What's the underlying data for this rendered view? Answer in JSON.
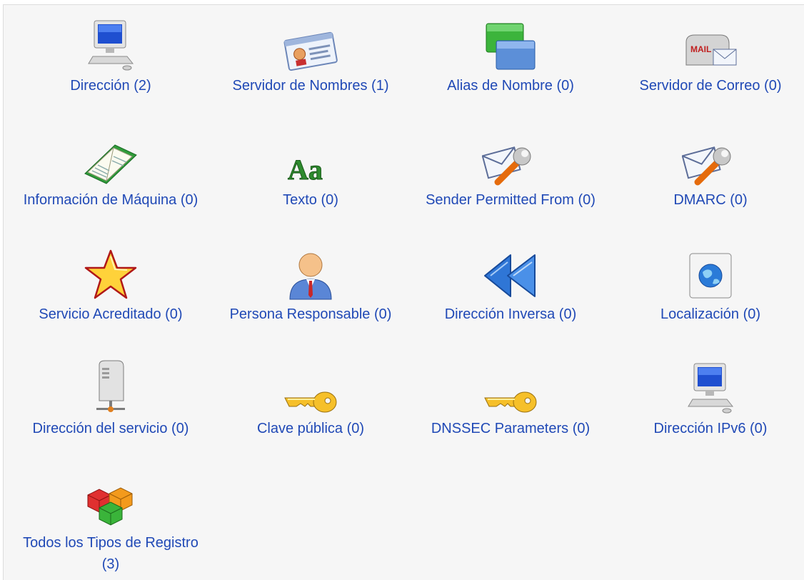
{
  "record_types": [
    {
      "id": "address",
      "icon": "computer-monitor-icon",
      "label": "Dirección (2)"
    },
    {
      "id": "name-server",
      "icon": "id-card-icon",
      "label": "Servidor de Nombres (1)"
    },
    {
      "id": "name-alias",
      "icon": "alias-windows-icon",
      "label": "Alias de Nombre (0)"
    },
    {
      "id": "mail-server",
      "icon": "mailbox-icon",
      "label": "Servidor de Correo (0)"
    },
    {
      "id": "host-info",
      "icon": "open-book-icon",
      "label": "Información de Máquina (0)"
    },
    {
      "id": "text",
      "icon": "text-aa-icon",
      "label": "Texto (0)"
    },
    {
      "id": "spf",
      "icon": "mail-wrench-icon",
      "label": "Sender Permitted From (0)"
    },
    {
      "id": "dmarc",
      "icon": "mail-wrench-icon",
      "label": "DMARC (0)"
    },
    {
      "id": "well-known-service",
      "icon": "star-icon",
      "label": "Servicio Acreditado (0)"
    },
    {
      "id": "responsible-person",
      "icon": "person-icon",
      "label": "Persona Responsable (0)"
    },
    {
      "id": "reverse-address",
      "icon": "rewind-arrows-icon",
      "label": "Dirección Inversa (0)"
    },
    {
      "id": "location",
      "icon": "globe-icon",
      "label": "Localización (0)"
    },
    {
      "id": "service-address",
      "icon": "server-tower-icon",
      "label": "Dirección del servicio (0)"
    },
    {
      "id": "public-key",
      "icon": "key-icon",
      "label": "Clave pública (0)"
    },
    {
      "id": "dnssec-parameters",
      "icon": "key-icon",
      "label": "DNSSEC Parameters (0)"
    },
    {
      "id": "ipv6-address",
      "icon": "computer-monitor-icon",
      "label": "Dirección IPv6 (0)"
    },
    {
      "id": "all-record-types",
      "icon": "cubes-icon",
      "label": "Todos los Tipos de Registro (3)"
    }
  ],
  "colors": {
    "link": "#2049b6",
    "panel_background": "#f6f6f6"
  }
}
